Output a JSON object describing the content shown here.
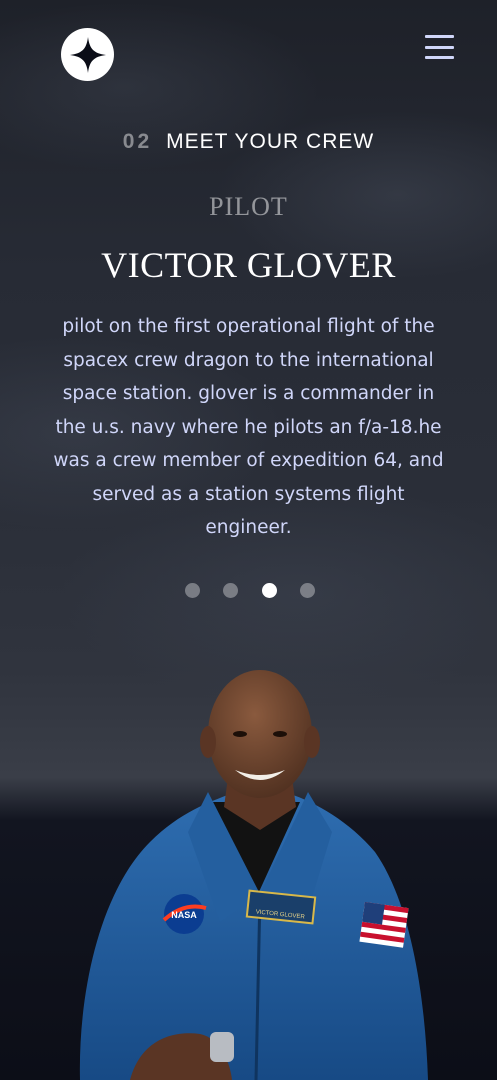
{
  "header": {
    "logo_icon": "star-logo-icon",
    "menu_icon": "hamburger-menu-icon"
  },
  "section": {
    "number": "02",
    "title": "MEET YOUR CREW"
  },
  "crew": {
    "role": "PILOT",
    "name": "VICTOR GLOVER",
    "bio": "pilot on the first operational flight of the spacex crew dragon to the international space station. glover is a commander in the u.s. navy where he pilots an f/a-18.he was a crew member of expedition 64, and served as a station systems flight engineer."
  },
  "carousel": {
    "count": 4,
    "active_index": 2
  },
  "photo": {
    "subject": "astronaut-portrait",
    "badge_text": "NASA",
    "name_tag": "VICTOR GLOVER"
  },
  "colors": {
    "accent": "#d0d6f9",
    "text": "#ffffff"
  }
}
